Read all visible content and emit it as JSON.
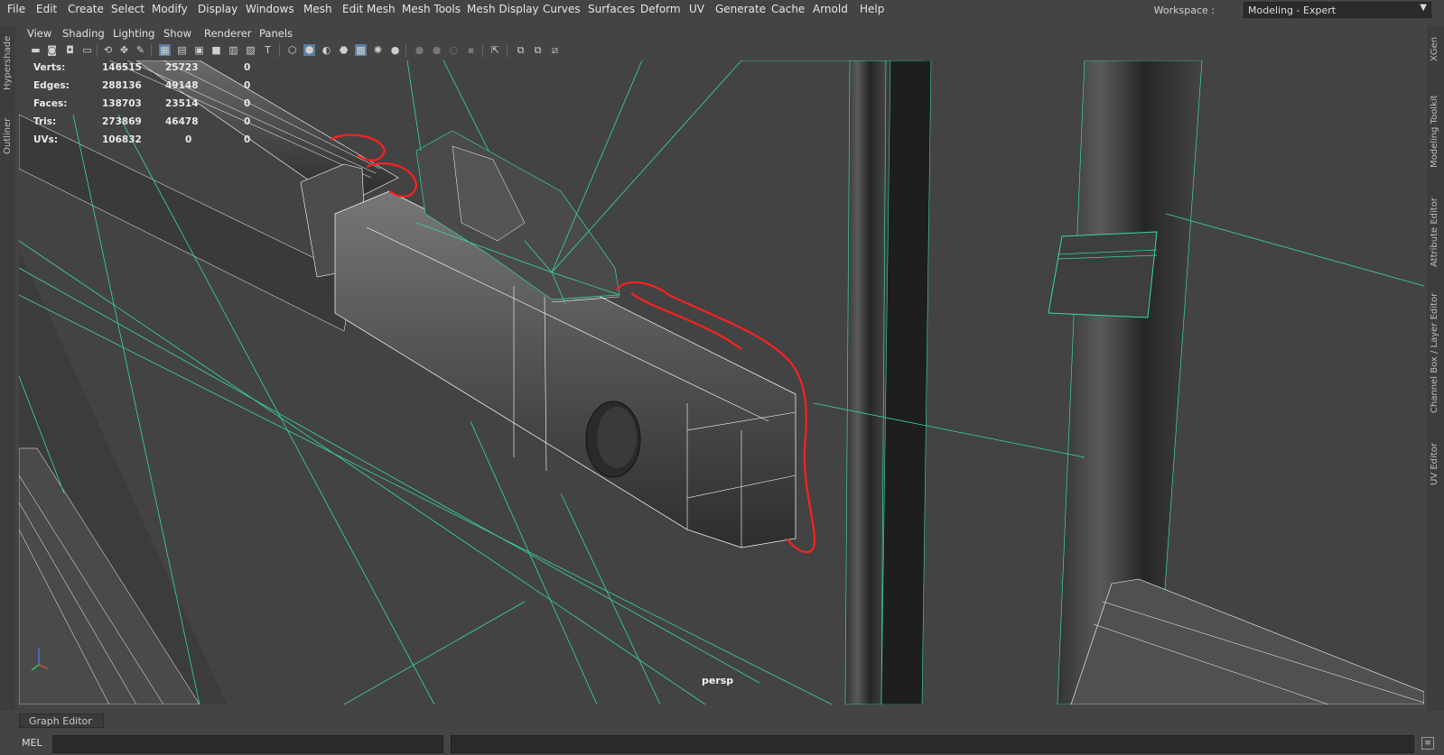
{
  "menubar": {
    "items": [
      "File",
      "Edit",
      "Create",
      "Select",
      "Modify",
      "Display",
      "Windows",
      "Mesh",
      "Edit Mesh",
      "Mesh Tools",
      "Mesh Display",
      "Curves",
      "Surfaces",
      "Deform",
      "UV",
      "Generate",
      "Cache",
      "Arnold",
      "Help"
    ],
    "workspace_label": "Workspace :",
    "workspace_value": "Modeling - Expert"
  },
  "left_tabs": [
    "Hypershade",
    "Outliner"
  ],
  "right_tabs": [
    "XGen",
    "Modeling Toolkit",
    "Attribute Editor",
    "Channel Box / Layer Editor",
    "UV Editor"
  ],
  "panel_menu": [
    "View",
    "Shading",
    "Lighting",
    "Show",
    "Renderer",
    "Panels"
  ],
  "toolbar_icons": [
    "camera-select-icon",
    "camera-attributes-icon",
    "bookmark-icon",
    "image-plane-icon",
    "grid-icon",
    "film-gate-icon",
    "resolution-gate-icon",
    "gate-mask-icon",
    "field-chart-icon",
    "safe-action-icon",
    "safe-title-icon",
    "wireframe-icon",
    "smooth-shade-icon",
    "default-material-icon",
    "wireframe-on-shaded-icon",
    "xray-icon",
    "lights-icon",
    "shadows-icon",
    "ambient-occlusion-icon",
    "motion-blur-icon",
    "anti-aliasing-icon",
    "depth-of-field-icon",
    "isolate-select-icon",
    "xray-joints-icon",
    "xray-active-icon",
    "texture-icon"
  ],
  "hud": {
    "rows": [
      {
        "label": "Verts:",
        "total": "146515",
        "selected": "25723",
        "extra": "0"
      },
      {
        "label": "Edges:",
        "total": "288136",
        "selected": "49148",
        "extra": "0"
      },
      {
        "label": "Faces:",
        "total": "138703",
        "selected": "23514",
        "extra": "0"
      },
      {
        "label": "Tris:",
        "total": "273869",
        "selected": "46478",
        "extra": "0"
      },
      {
        "label": "UVs:",
        "total": "106832",
        "selected": "0",
        "extra": "0"
      }
    ]
  },
  "viewport": {
    "camera_label": "persp",
    "wire_color": "#36d9a0",
    "annotation_color": "#ff2020"
  },
  "bottom_tab": "Graph Editor",
  "command_line": {
    "mode_label": "MEL"
  }
}
